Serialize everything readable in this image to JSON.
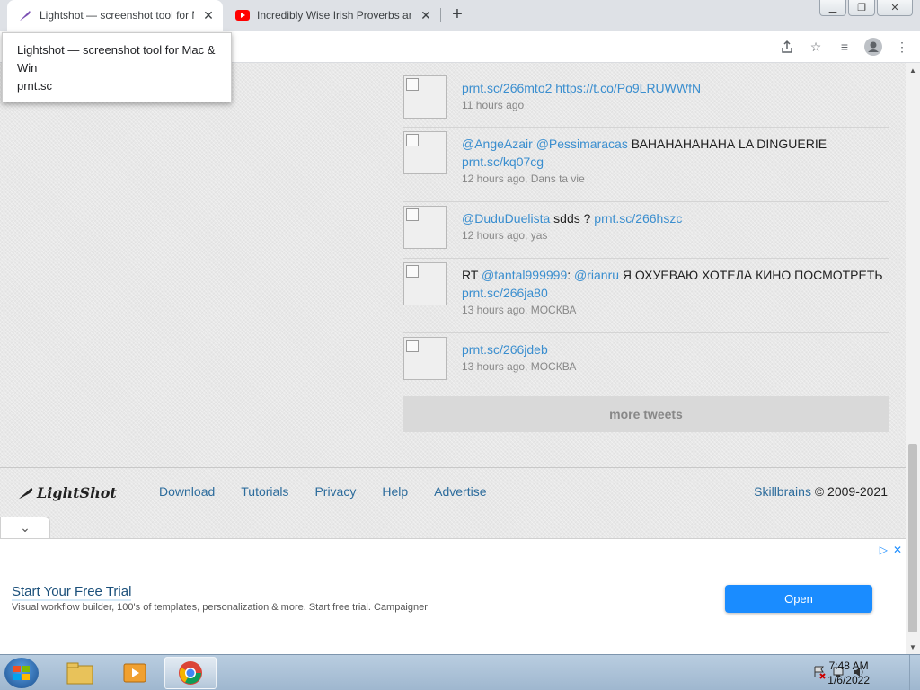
{
  "browser": {
    "tabs": [
      {
        "title": "Lightshot — screenshot tool for M",
        "active": true,
        "icon": "feather-icon"
      },
      {
        "title": "Incredibly Wise Irish Proverbs an",
        "active": false,
        "icon": "youtube-icon"
      }
    ],
    "new_tab": "+",
    "tooltip": {
      "title": "Lightshot — screenshot tool for Mac & Win",
      "url": "prnt.sc"
    }
  },
  "tweets": [
    {
      "parts": [
        {
          "t": "prnt.sc/266mto2 https://t.co/Po9LRUWWfN",
          "link": true
        }
      ],
      "meta": "11 hours ago"
    },
    {
      "parts": [
        {
          "t": "@AngeAzair @Pessimaracas",
          "link": true
        },
        {
          "t": " ВАНАНАНАНАНА LA DINGUERIE ",
          "link": false
        },
        {
          "t": "prnt.sc/kq07cg",
          "link": true
        }
      ],
      "meta": "12 hours ago, Dans ta vie"
    },
    {
      "parts": [
        {
          "t": "@DuduDuelista",
          "link": true
        },
        {
          "t": " sdds ? ",
          "link": false
        },
        {
          "t": "prnt.sc/266hszc",
          "link": true
        }
      ],
      "meta": "12 hours ago, yas"
    },
    {
      "parts": [
        {
          "t": "RT ",
          "link": false
        },
        {
          "t": "@tantal999999",
          "link": true
        },
        {
          "t": ": ",
          "link": false
        },
        {
          "t": "@rianru",
          "link": true
        },
        {
          "t": " Я ОХУЕВАЮ ХОТЕЛА КИНО ПОСМОТРЕТЬ ",
          "link": false
        },
        {
          "t": "prnt.sc/266ja80",
          "link": true
        }
      ],
      "meta": "13 hours ago, МОСКВА"
    },
    {
      "parts": [
        {
          "t": "prnt.sc/266jdeb",
          "link": true
        }
      ],
      "meta": "13 hours ago, МОСКВА"
    }
  ],
  "more_tweets": "more tweets",
  "footer": {
    "logo": "LightShot",
    "nav": [
      "Download",
      "Tutorials",
      "Privacy",
      "Help",
      "Advertise"
    ],
    "company": "Skillbrains",
    "copyright": " © 2009-2021"
  },
  "ad": {
    "title": "Start Your Free Trial",
    "description": "Visual workflow builder, 100's of templates, personalization & more. Start free trial. Campaigner",
    "button": "Open",
    "accent": "#1a8cff"
  },
  "taskbar": {
    "time": "7:48 AM",
    "date": "1/6/2022"
  }
}
